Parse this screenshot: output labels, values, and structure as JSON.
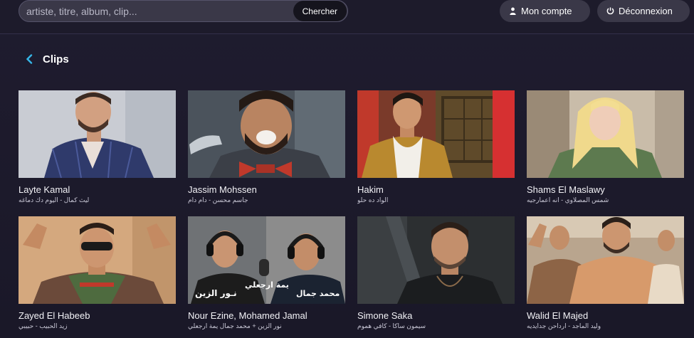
{
  "search": {
    "placeholder": "artiste, titre, album, clip...",
    "button_label": "Chercher"
  },
  "header": {
    "account_label": "Mon compte",
    "logout_label": "Déconnexion"
  },
  "section": {
    "title": "Clips"
  },
  "clips": [
    {
      "artist": "Layte Kamal",
      "subtitle": "ليث كمال - اليوم دك دماغه"
    },
    {
      "artist": "Jassim Mohssen",
      "subtitle": "جاسم محسن - دام دام"
    },
    {
      "artist": "Hakim",
      "subtitle": "الواد ده حلو"
    },
    {
      "artist": "Shams El Maslawy",
      "subtitle": "شمس المصلاوي - انه اعمارجيه"
    },
    {
      "artist": "Zayed El Habeeb",
      "subtitle": "زيد الحبيب - حبيبي"
    },
    {
      "artist": "Nour Ezine, Mohamed Jamal",
      "subtitle": "نور الزين + محمد جمال يمة ارجعلي"
    },
    {
      "artist": "Simone Saka",
      "subtitle": "سيمون ساكا - كافي هموم"
    },
    {
      "artist": "Walid El Majed",
      "subtitle": "وليد الماجد - ارداحن جدايديه"
    }
  ],
  "thumb_overlays": {
    "clip6_left": "نـور الزين",
    "clip6_mid": "يمة ارجعلي",
    "clip6_right": "محمد جمال"
  },
  "colors": {
    "background": "#1f1c2f",
    "pill": "#3a3848",
    "accent": "#36b6e8"
  }
}
